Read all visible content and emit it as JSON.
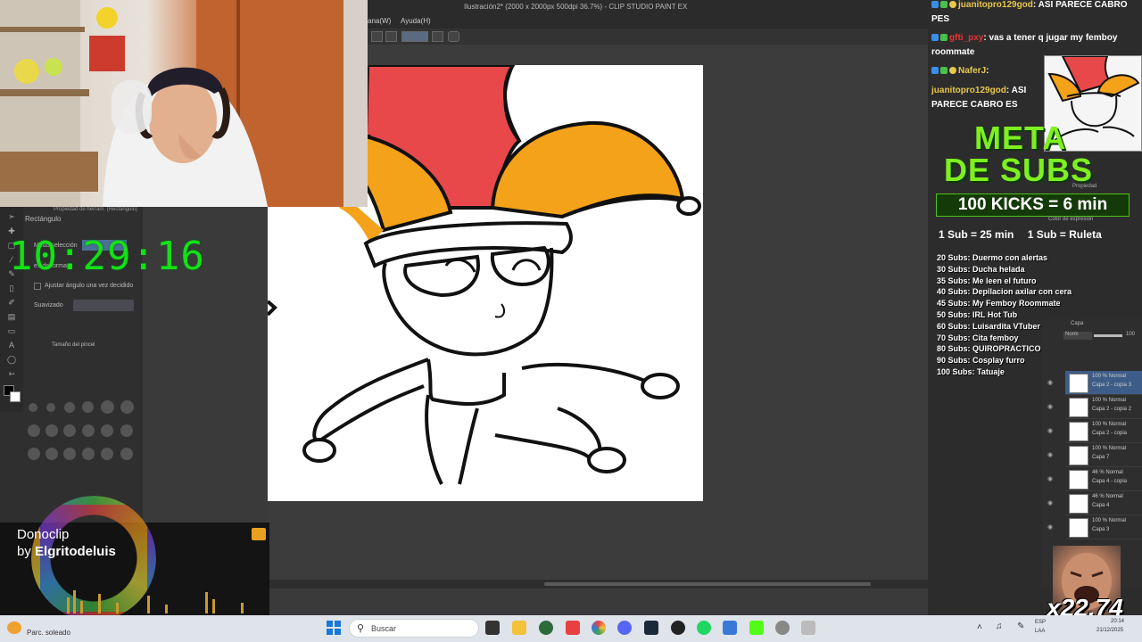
{
  "app": {
    "title": "Ilustración2* (2000 x 2000px 500dpi 36.7%) - CLIP STUDIO PAINT EX",
    "menu": [
      "ana(W)",
      "Ayuda(H)"
    ]
  },
  "left_panel": {
    "tool_name": "Rectángulo",
    "prop_header": "Propiedad de herram. (Rectángulo)",
    "mode_label": "Modo selección",
    "mode2_label": "es de forma",
    "angle_checkbox": "Ajustar ángulo una vez decidido",
    "smooth_label": "Suavizado",
    "brush_size_header": "Tamaño del pincel"
  },
  "timer": "10:29:16",
  "donoclip": {
    "line1": "Donoclip",
    "by": "by ",
    "author": "Elgritodeluis"
  },
  "chat": {
    "messages": [
      {
        "user": "juanitopro129god",
        "text": ": ASI PARECE CABRO PES",
        "user_color": "#e8c74a"
      },
      {
        "user": "gfti_pxy",
        "text": ": vas a tener q jugar my femboy roommate",
        "user_color": "#e83434"
      },
      {
        "user": "NaferJ",
        "text": ":",
        "user_color": "#e8c74a"
      },
      {
        "user": "juanitopro129god",
        "text": ": ASI PARECE CABRO ES",
        "user_color": "#e8c74a"
      }
    ]
  },
  "goals_overlay": {
    "title_line1": "META",
    "title_line2": "DE SUBS",
    "kicks": "100 KICKS = 6 min",
    "rate1": "1 Sub = 25 min",
    "rate2": "1 Sub = Ruleta",
    "goals": [
      "20 Subs: Duermo con alertas",
      "30 Subs: Ducha helada",
      "35 Subs: Me leen el futuro",
      "40 Subs: Depilacion axilar con cera",
      "45 Subs: My Femboy Roommate",
      "50 Subs: IRL Hot Tub",
      "60 Subs: Luisardita VTuber",
      "70 Subs: Cita femboy",
      "80 Subs: QUIROPRACTICO",
      "90 Subs: Cosplay furro",
      "100 Subs: Tatuaje"
    ]
  },
  "layers_panel": {
    "header": "Capa",
    "blend": "Norm",
    "opacity": "100",
    "layers": [
      {
        "mode": "100 % Normal",
        "name": "Capa 2 - copia 3"
      },
      {
        "mode": "100 % Normal",
        "name": "Capa 2 - copia 2"
      },
      {
        "mode": "100 % Normal",
        "name": "Capa 2 - copia"
      },
      {
        "mode": "100 % Normal",
        "name": "Capa 7"
      },
      {
        "mode": "46 % Normal",
        "name": "Capa 4 - copia"
      },
      {
        "mode": "46 % Normal",
        "name": "Capa 4"
      },
      {
        "mode": "100 % Normal",
        "name": "Capa 3"
      }
    ],
    "extra_labels": [
      "Propiedad",
      "Color de expresión"
    ]
  },
  "kick_counter": "x22.74",
  "taskbar": {
    "weather": "Parc. soleado",
    "search_placeholder": "Buscar",
    "lang": "ESP",
    "lang2": "LAA",
    "time": "20:14",
    "date": "21/12/2025"
  },
  "colors": {
    "timer_green": "#16e016",
    "meta_green": "#7ef020",
    "jester_red": "#e8484a",
    "jester_orange": "#f3a21a"
  }
}
